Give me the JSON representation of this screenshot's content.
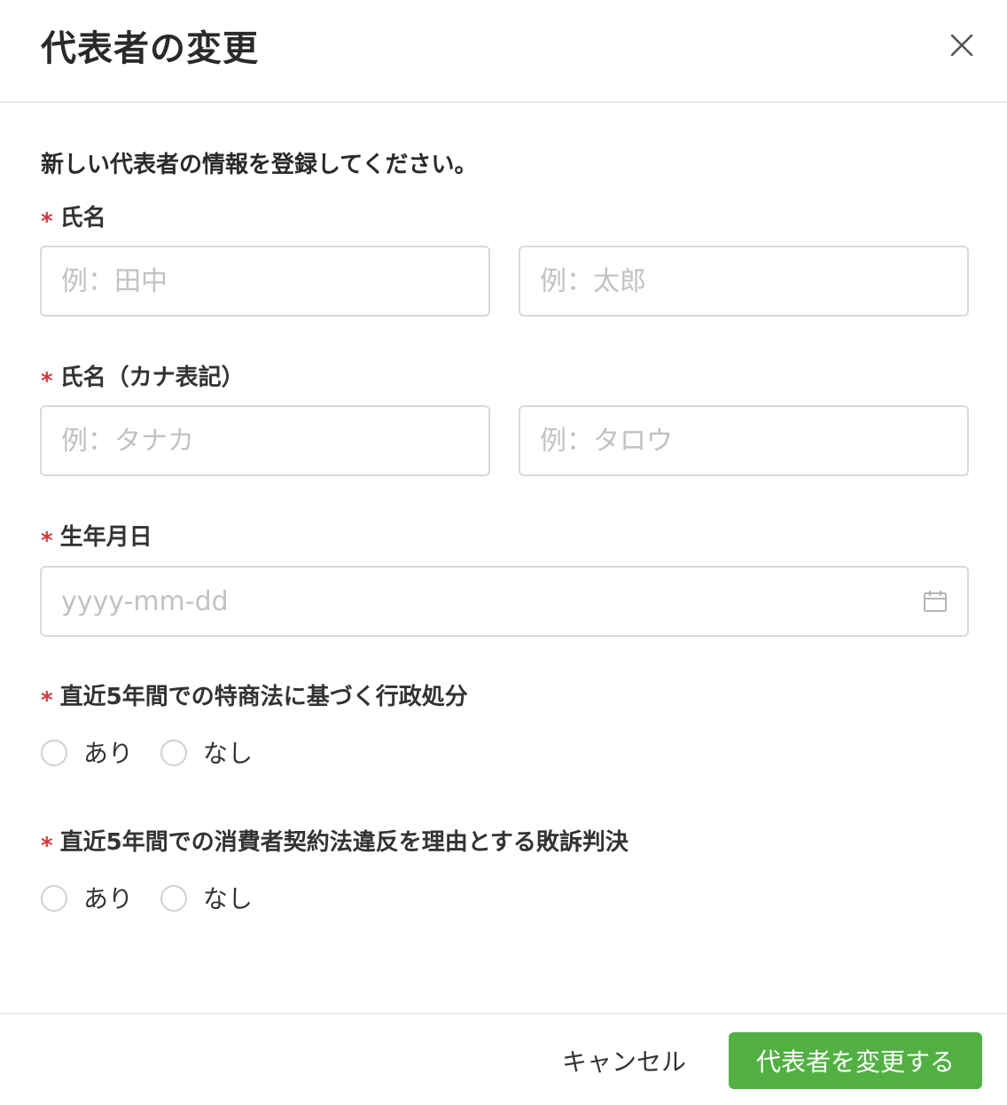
{
  "modal": {
    "title": "代表者の変更",
    "close_icon": "close-icon"
  },
  "form": {
    "lead": "新しい代表者の情報を登録してください。",
    "required_mark": "*",
    "name": {
      "label": "氏名",
      "last_placeholder": "例：田中",
      "first_placeholder": "例：太郎"
    },
    "kana": {
      "label": "氏名（カナ表記）",
      "last_placeholder": "例：タナカ",
      "first_placeholder": "例：タロウ"
    },
    "birthdate": {
      "label": "生年月日",
      "placeholder": "yyyy-mm-dd",
      "icon": "calendar-icon"
    },
    "q1": {
      "label": "直近5年間での特商法に基づく行政処分",
      "options": [
        "あり",
        "なし"
      ]
    },
    "q2": {
      "label": "直近5年間での消費者契約法違反を理由とする敗訴判決",
      "options": [
        "あり",
        "なし"
      ]
    }
  },
  "footer": {
    "cancel_label": "キャンセル",
    "submit_label": "代表者を変更する"
  },
  "colors": {
    "primary": "#52b043",
    "required": "#d9363e",
    "border": "#d9d9d9",
    "placeholder": "#c2c2c2"
  }
}
